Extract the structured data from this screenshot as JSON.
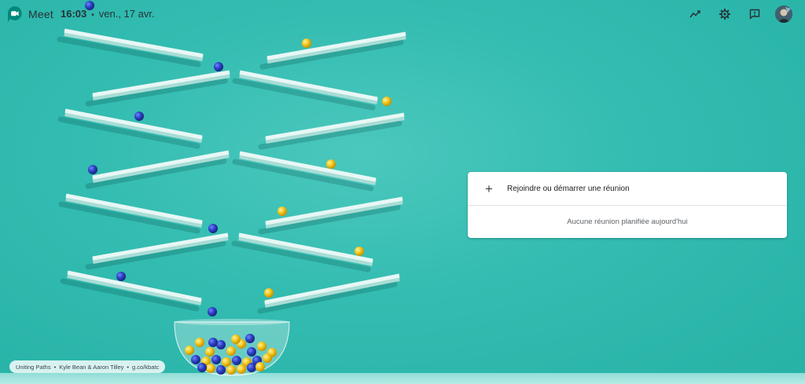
{
  "header": {
    "app_name": "Meet",
    "time": "16:03",
    "separator": "•",
    "date": "ven., 17 avr."
  },
  "icons": {
    "logo": "google-meet-logo",
    "activity": "trending-up-icon",
    "settings": "gear-icon",
    "feedback": "feedback-icon",
    "account": "avatar"
  },
  "card": {
    "join_label": "Rejoindre ou démarrer une réunion",
    "join_icon": "+",
    "empty_note": "Aucune réunion planifiée aujourd'hui"
  },
  "credit": {
    "title": "Uniting Paths",
    "artists": "Kyle Bean & Aaron Tilley",
    "link": "g.co/kbatc",
    "separator": "•"
  },
  "colors": {
    "background": "#33bcb1",
    "ball_blue": "#2b3fc4",
    "ball_yellow": "#f2c418",
    "meet_green": "#00897b"
  }
}
